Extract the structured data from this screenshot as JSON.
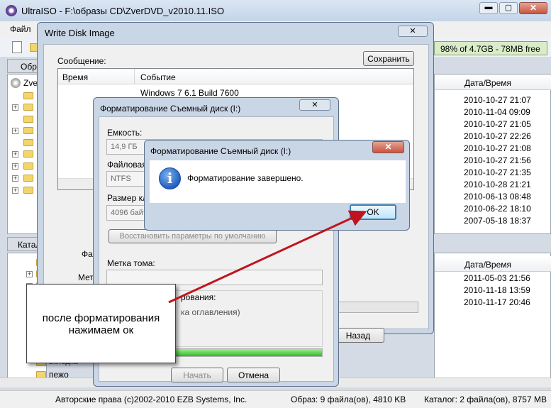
{
  "main": {
    "title": "UltraISO - F:\\образы CD\\ZverDVD_v2010.11.ISO",
    "menu_file": "Файл",
    "capacity": "98% of 4.7GB - 78MB free",
    "tab_top": "Обра",
    "tab_bottom": "Катал",
    "tree_root": "Zve",
    "tree_bottom_item_1": "вкладка",
    "tree_bottom_item_2": "пежо",
    "col_date_top": "Дата/Время",
    "col_date_bottom": "Дата/Время",
    "dates_top": [
      "2010-10-27 21:07",
      "2010-11-04 09:09",
      "2010-10-27 21:05",
      "2010-10-27 22:26",
      "2010-10-27 21:08",
      "2010-10-27 21:56",
      "2010-10-27 21:35",
      "2010-10-28 21:21",
      "2010-06-13 08:48",
      "2010-06-22 18:10",
      "2007-05-18 18:37"
    ],
    "dates_bottom": [
      "2011-05-03 21:56",
      "2010-11-18 13:59",
      "2010-11-17 20:46"
    ],
    "status_copyright": "Авторские права (c)2002-2010 EZB Systems, Inc.",
    "status_image": "Образ: 9 файла(ов), 4810 KB",
    "status_catalog": "Каталог: 2 файла(ов), 8757 MB"
  },
  "write_dialog": {
    "title": "Write Disk Image",
    "message_label": "Сообщение:",
    "save_button": "Сохранить",
    "col_time": "Время",
    "col_event": "Событие",
    "log_row": "Windows 7 6.1 Build 7600",
    "label_fa": "Фай",
    "label_meto": "Мето",
    "back_button": "Назад"
  },
  "format_dialog": {
    "title": "Форматирование Съемный диск (I:)",
    "capacity_label": "Емкость:",
    "capacity_value": "14,9 ГБ",
    "fs_label": "Файловая",
    "fs_value": "NTFS",
    "cluster_label": "Размер кла",
    "cluster_value": "4096 байт",
    "restore_button": "Восстановить параметры по умолчанию",
    "volume_label": "Метка тома:",
    "options_label": "рования:",
    "quick_label": "ка оглавления)",
    "start_button": "Начать",
    "cancel_button": "Отмена"
  },
  "done_dialog": {
    "title": "Форматирование Съемный диск (I:)",
    "message": "Форматирование завершено.",
    "ok_button": "OK"
  },
  "callout": {
    "line1": "после форматирования",
    "line2": "нажимаем ок",
    "arrow_color": "#c0141c"
  }
}
